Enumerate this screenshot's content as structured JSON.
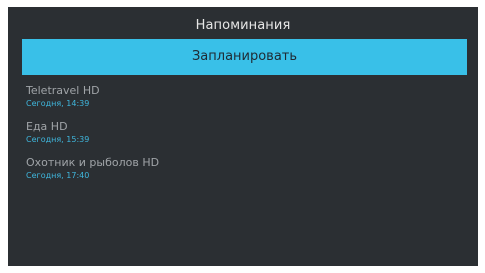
{
  "header": {
    "title": "Напоминания"
  },
  "schedule_button": {
    "label": "Запланировать"
  },
  "reminders": [
    {
      "channel": "Teletravel HD",
      "time": "Сегодня, 14:39"
    },
    {
      "channel": "Еда HD",
      "time": "Сегодня, 15:39"
    },
    {
      "channel": "Охотник и рыболов HD",
      "time": "Сегодня, 17:40"
    }
  ],
  "colors": {
    "background": "#2b2f33",
    "accent": "#39c0e8",
    "time_text": "#3fb6dc",
    "channel_text": "#a0a4a8"
  }
}
